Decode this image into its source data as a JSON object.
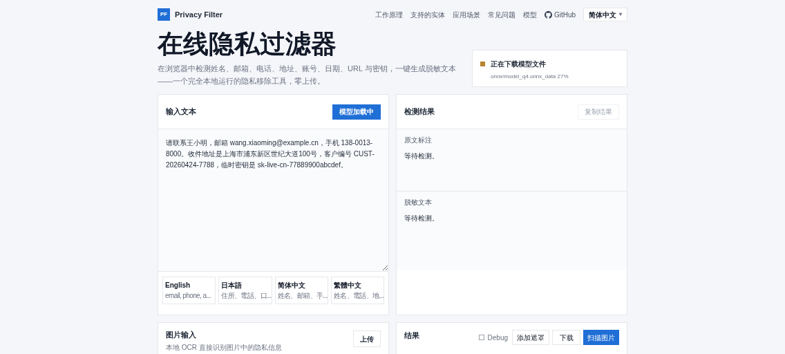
{
  "brand": {
    "logo": "PF",
    "name": "Privacy Filter"
  },
  "nav": [
    "工作原理",
    "支持的实体",
    "应用场景",
    "常见问题",
    "模型",
    "GitHub"
  ],
  "language_select": {
    "value": "简体中文",
    "caret": "▾"
  },
  "hero": {
    "title": "在线隐私过滤器",
    "subtitle": "在浏览器中检测姓名、邮箱、电话、地址、账号、日期、URL 与密钥，一键生成脱敏文本——一个完全本地运行的隐私移除工具，零上传。"
  },
  "status": {
    "title": "正在下载模型文件",
    "detail": "onnx/model_q4.onnx_data 27%",
    "color": "#b7832f"
  },
  "input_panel": {
    "title": "输入文本",
    "button": "模型加载中",
    "text": "请联系王小明，邮箱 wang.xiaoming@example.cn，手机 138-0013-8000。收件地址是上海市浦东新区世纪大道100号，客户编号 CUST-20260424-7788，临时密钥是 sk-live-cn-77889900abcdef。",
    "presets": [
      {
        "title": "English",
        "desc": "email, phone, a..."
      },
      {
        "title": "日本語",
        "desc": "住所、電話、口..."
      },
      {
        "title": "简体中文",
        "desc": "姓名、邮箱、手..."
      },
      {
        "title": "繁體中文",
        "desc": "姓名、電話、地..."
      }
    ]
  },
  "result_panel": {
    "title": "检测结果",
    "button": "复制结果",
    "sections": [
      {
        "label": "原文标注",
        "text": "等待检测。"
      },
      {
        "label": "脱敏文本",
        "text": "等待检测。"
      }
    ]
  },
  "image_panel": {
    "title": "图片输入",
    "subtitle": "本地 OCR 直接识别图片中的隐私信息",
    "button": "上传"
  },
  "output_panel": {
    "title": "结果",
    "debug": {
      "label": "Debug",
      "checked": false
    },
    "buttons": [
      {
        "label": "添加遮罩",
        "primary": false
      },
      {
        "label": "下载",
        "primary": false
      },
      {
        "label": "扫描图片",
        "primary": true
      }
    ]
  }
}
